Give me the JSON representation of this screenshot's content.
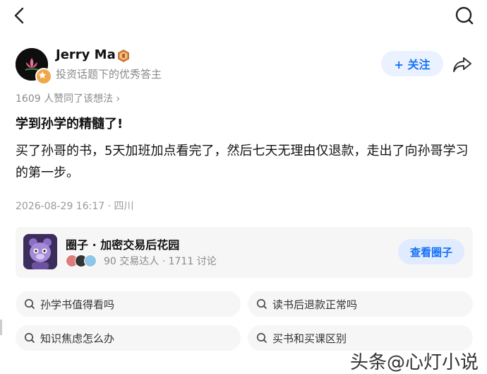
{
  "author": {
    "name": "Jerry Ma",
    "description": "投资话题下的优秀答主"
  },
  "follow_label": "+ 关注",
  "likes_text": "1609 人赞同了该想法",
  "post": {
    "title": "学到孙学的精髓了!",
    "body": "买了孙哥的书，5天加班加点看完了，然后七天无理由仅退款，走出了向孙哥学习的第一步。",
    "time": "2026-08-29 16:17 · 四川"
  },
  "circle": {
    "name": "圈子 · 加密交易后花园",
    "meta": "90 交易达人 · 1711 讨论",
    "button": "查看圈子"
  },
  "related_searches": [
    "孙学书值得看吗",
    "读书后退款正常吗",
    "知识焦虑怎么办",
    "买书和买课区别"
  ],
  "watermark": "头条@心灯小说",
  "colors": {
    "accent": "#1772f6",
    "follow_bg": "#eaf2ff"
  },
  "icons": [
    "back-arrow-icon",
    "search-icon",
    "share-icon",
    "search-small-icon"
  ]
}
